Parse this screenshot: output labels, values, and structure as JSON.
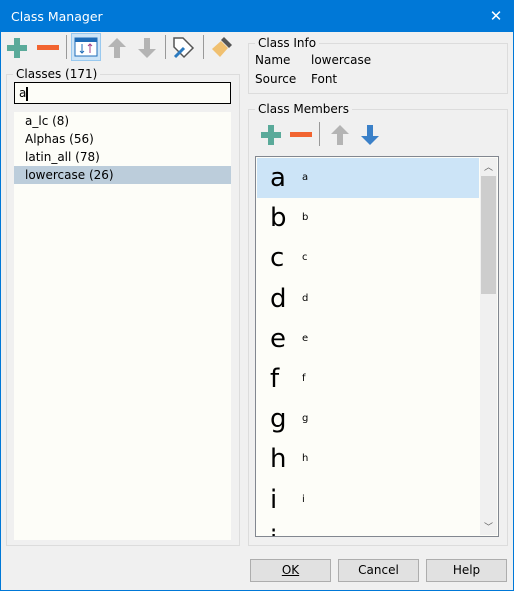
{
  "window": {
    "title": "Class Manager",
    "close": "✕"
  },
  "toolbar": {
    "icons": [
      "plus-icon",
      "minus-icon",
      "sort-icon",
      "arrow-up-icon",
      "arrow-down-icon",
      "tag-edit-icon",
      "brush-icon"
    ],
    "accent_plus": "#5aaa9a",
    "accent_minus": "#f26430"
  },
  "classes": {
    "label": "Classes (171)",
    "search_value": "a",
    "items": [
      {
        "label": "a_lc (8)"
      },
      {
        "label": "Alphas (56)"
      },
      {
        "label": "latin_all (78)"
      },
      {
        "label": "lowercase (26)",
        "selected": true
      }
    ]
  },
  "class_info": {
    "label": "Class Info",
    "name_label": "Name",
    "name_value": "lowercase",
    "source_label": "Source",
    "source_value": "Font"
  },
  "class_members": {
    "label": "Class Members",
    "items": [
      {
        "glyph": "a",
        "name": "a",
        "selected": true
      },
      {
        "glyph": "b",
        "name": "b"
      },
      {
        "glyph": "c",
        "name": "c"
      },
      {
        "glyph": "d",
        "name": "d"
      },
      {
        "glyph": "e",
        "name": "e"
      },
      {
        "glyph": "f",
        "name": "f"
      },
      {
        "glyph": "g",
        "name": "g"
      },
      {
        "glyph": "h",
        "name": "h"
      },
      {
        "glyph": "i",
        "name": "i"
      },
      {
        "glyph": "j",
        "name": ""
      }
    ]
  },
  "buttons": {
    "ok": "OK",
    "cancel": "Cancel",
    "help": "Help"
  }
}
